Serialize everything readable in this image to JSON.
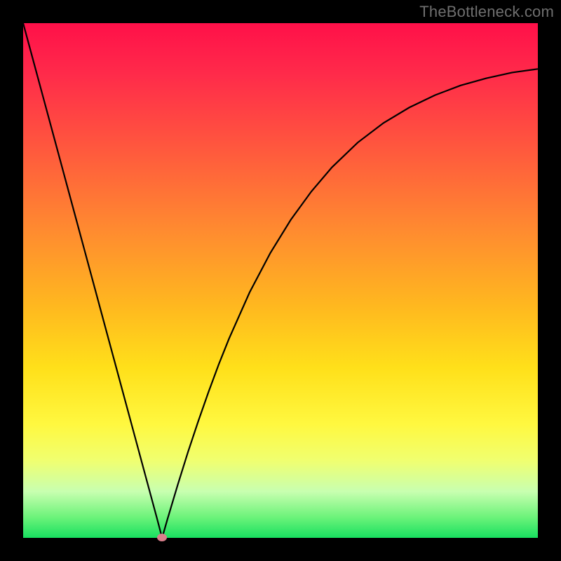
{
  "watermark": "TheBottleneck.com",
  "chart_data": {
    "type": "line",
    "title": "",
    "xlabel": "",
    "ylabel": "",
    "xlim": [
      0,
      100
    ],
    "ylim": [
      0,
      100
    ],
    "x": [
      0,
      2,
      4,
      6,
      8,
      10,
      12,
      14,
      16,
      18,
      20,
      22,
      24,
      26,
      27,
      28,
      30,
      32,
      34,
      36,
      38,
      40,
      44,
      48,
      52,
      56,
      60,
      65,
      70,
      75,
      80,
      85,
      90,
      95,
      100
    ],
    "y": [
      100,
      92.6,
      85.2,
      77.8,
      70.4,
      63,
      55.6,
      48.2,
      40.8,
      33.4,
      26,
      18.6,
      11.2,
      3.8,
      0,
      3.5,
      10.2,
      16.6,
      22.6,
      28.3,
      33.7,
      38.7,
      47.7,
      55.3,
      61.8,
      67.3,
      72,
      76.8,
      80.6,
      83.6,
      86,
      87.9,
      89.3,
      90.4,
      91.1
    ],
    "marker": {
      "x": 27,
      "y": 0
    },
    "colors": {
      "top": "#ff1049",
      "mid": "#ffe01a",
      "bottom": "#18e060",
      "curve": "#000000",
      "marker": "#d97f8b"
    }
  }
}
